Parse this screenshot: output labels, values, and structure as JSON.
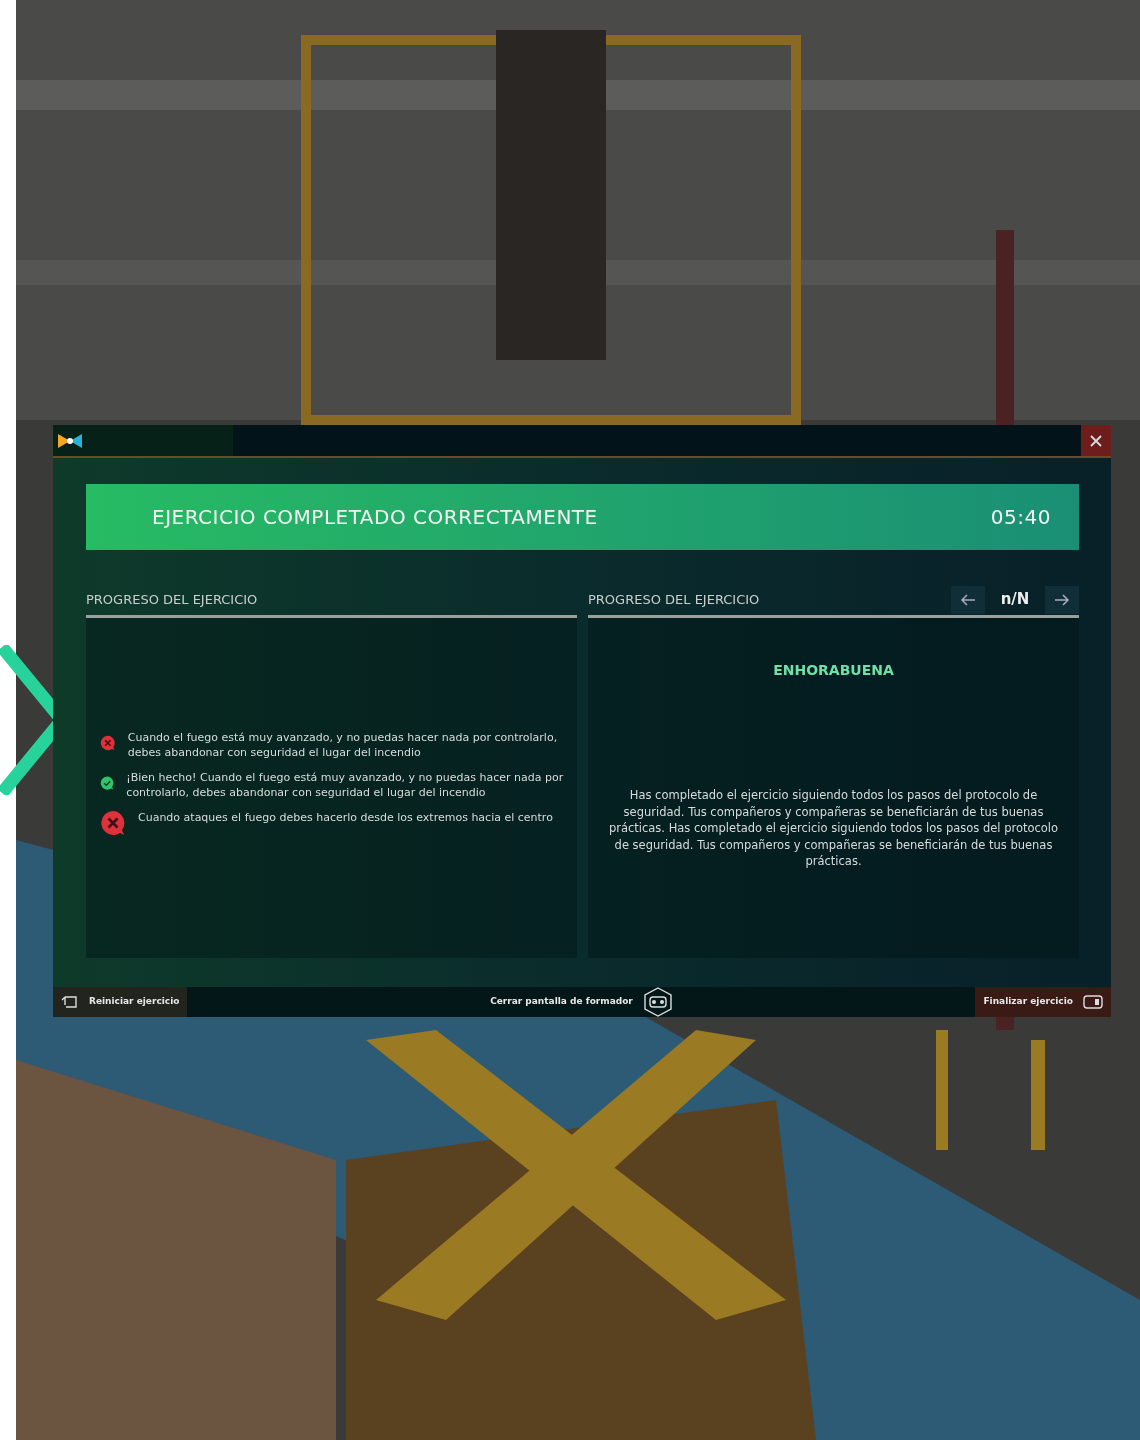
{
  "header": {
    "title": "EJERCICIO COMPLETADO CORRECTAMENTE",
    "time": "05:40"
  },
  "left_panel": {
    "heading": "PROGRESO DEL EJERCICIO",
    "results": [
      {
        "kind": "wrong",
        "text": "Cuando el fuego está muy avanzado, y no puedas hacer nada por controlarlo, debes abandonar con seguridad el lugar del incendio"
      },
      {
        "kind": "right",
        "text": "¡Bien hecho! Cuando el fuego está muy avanzado, y no puedas hacer nada por controlarlo, debes abandonar con seguridad el lugar del incendio"
      },
      {
        "kind": "wrong",
        "text": "Cuando ataques el fuego debes hacerlo desde los extremos hacia el centro"
      }
    ]
  },
  "right_panel": {
    "heading": "PROGRESO DEL EJERCICIO",
    "pager": "n/N",
    "title": "ENHORABUENA",
    "message": "Has completado el ejercicio siguiendo todos los pasos del protocolo de seguridad. Tus compañeros y compañeras se beneficiarán de tus buenas prácticas. Has completado el ejercicio siguiendo todos los pasos del protocolo de seguridad. Tus compañeros y compañeras se beneficiarán de tus buenas prácticas."
  },
  "footer": {
    "restart": "Reiniciar ejercicio",
    "close_trainer": "Cerrar pantalla de formador",
    "finish": "Finalizar ejercicio"
  }
}
